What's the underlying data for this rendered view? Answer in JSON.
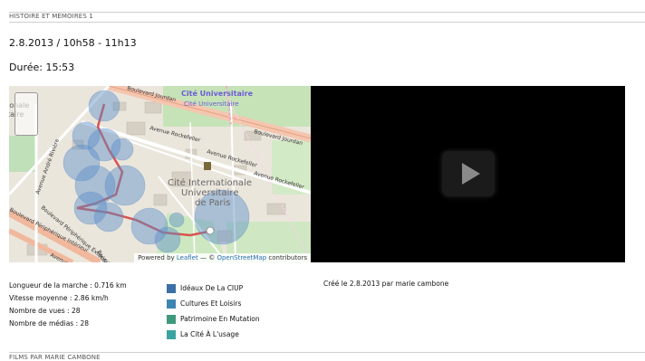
{
  "header": {
    "section_label": "HISTOIRE ET MÉMOIRES 1",
    "date_time": "2.8.2013 / 10h58 - 11h13",
    "duration": "Durée: 15:53"
  },
  "map": {
    "labels": {
      "cite_universitaire": "Cité Universitaire",
      "cite_universitaire_sub": "Cité Universitaire",
      "boulevard_jourdan_top": "Boulevard Jourdan",
      "boulevard_jourdan_right": "Boulevard Jourdan",
      "avenue_rockefeller_1": "Avenue Rockefeller",
      "avenue_rockefeller_2": "Avenue Rockefeller",
      "avenue_rockefeller_3": "Avenue Rockefeller",
      "avenue_andre_riviere": "Avenue André Rivière",
      "boulevard_peripherique": "Boulevard Périphérique Intérieur",
      "avenue_david_weill": "Avenue David Weill",
      "boulevard_peripherique_exterieur": "Boulevard Périphérique Extérieur",
      "boule": "Boule",
      "cite_line1": "Cité Internationale",
      "cite_line2": "Universitaire",
      "cite_line3": "de Paris",
      "left_edge_1": "ionale",
      "left_edge_2": "taire"
    },
    "attribution": {
      "powered_by": "Powered by",
      "leaflet": "Leaflet",
      "separator": "— ©",
      "osm": "OpenStreetMap",
      "contributors": "contributors"
    }
  },
  "stats": {
    "length": "Longueur de la marche : 0.716 km",
    "speed": "Vitesse moyenne : 2.86 km/h",
    "views": "Nombre de vues : 28",
    "media": "Nombre de médias : 28"
  },
  "tags": [
    {
      "label": "Idéaux De La CIUP",
      "color": "#3c6fa6"
    },
    {
      "label": "Cultures Et Loisirs",
      "color": "#3d86b0"
    },
    {
      "label": "Patrimoine En Mutation",
      "color": "#3f9a7d"
    },
    {
      "label": "La Cité À L'usage",
      "color": "#3aa5a0"
    }
  ],
  "created": "Créé le 2.8.2013 par marie cambone",
  "footer": {
    "section_label": "FILMS PAR MARIE CAMBONE"
  },
  "colors": {
    "map_background": "#e9e4d8",
    "track": "#d9534f",
    "circle": "#5a8fc9"
  }
}
